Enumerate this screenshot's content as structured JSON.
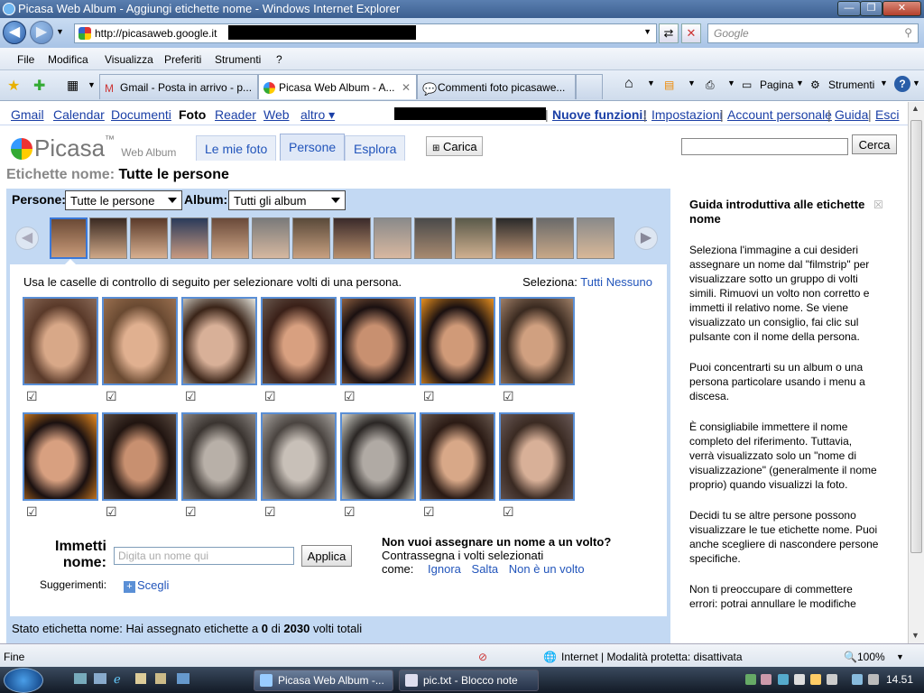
{
  "window": {
    "title": "Picasa Web Album - Aggiungi etichette nome - Windows Internet Explorer"
  },
  "address": {
    "url": "http://picasaweb.google.it",
    "search_placeholder": "Google"
  },
  "menu": [
    "File",
    "Modifica",
    "Visualizza",
    "Preferiti",
    "Strumenti",
    "?"
  ],
  "tabs": [
    {
      "label": "Gmail - Posta in arrivo - p..."
    },
    {
      "label": "Picasa Web Album - A..."
    },
    {
      "label": "Commenti foto picasawe..."
    }
  ],
  "toolbar": {
    "pagina": "Pagina",
    "strumenti": "Strumenti"
  },
  "gbar": {
    "links": [
      "Gmail",
      "Calendar",
      "Documenti",
      "Foto",
      "Reader",
      "Web",
      "altro ▾"
    ],
    "right": [
      "Nuove funzioni!",
      "Impostazioni",
      "Account personale",
      "Guida",
      "Esci"
    ]
  },
  "header": {
    "logo": "Picasa",
    "logo_sub": "Web Album",
    "tabs": [
      "Le mie foto",
      "Persone",
      "Esplora"
    ],
    "upload": "Carica",
    "search_button": "Cerca"
  },
  "page": {
    "title_prefix": "Etichette nome:",
    "title": "Tutte le persone",
    "persone_label": "Persone:",
    "persone_value": "Tutte le persone",
    "album_label": "Album:",
    "album_value": "Tutti gli album",
    "instructions": "Usa le caselle di controllo di seguito per selezionare volti di una persona.",
    "seleziona_label": "Seleziona:",
    "tutti": "Tutti",
    "nessuno": "Nessuno",
    "immetti_nome_1": "Immetti",
    "immetti_nome_2": "nome:",
    "name_placeholder": "Digita un nome qui",
    "applica": "Applica",
    "suggerimenti": "Suggerimenti:",
    "scegli": "Scegli",
    "no_name_title": "Non vuoi assegnare un nome a un volto?",
    "no_name_text1": "Contrassegna i volti selezionati",
    "no_name_text2": "come:",
    "ignora": "Ignora",
    "salta": "Salta",
    "non_volto": "Non è un volto",
    "status_prefix": "Stato etichetta nome:  Hai assegnato etichette a",
    "status_count": "0",
    "status_di": "di",
    "status_total": "2030",
    "status_suffix": "volti totali"
  },
  "guide": {
    "title": "Guida introduttiva alle etichette nome",
    "p1": "Seleziona l'immagine a cui desideri assegnare un nome dal \"filmstrip\" per visualizzare sotto un gruppo di volti simili. Rimuovi un volto non corretto e immetti il relativo nome. Se viene visualizzato un consiglio, fai clic sul pulsante con il nome della persona.",
    "p2": "Puoi concentrarti su un album o una persona particolare usando i menu a discesa.",
    "p3": "È consigliabile immettere il nome completo del riferimento. Tuttavia, verrà visualizzato solo un \"nome di visualizzazione\" (generalmente il nome proprio) quando visualizzi la foto.",
    "p4": "Decidi tu se altre persone possono visualizzare le tue etichette nome. Puoi anche scegliere di nascondere persone specifiche.",
    "p5": "Non ti preoccupare di commettere errori: potrai annullare le modifiche"
  },
  "statusbar": {
    "left": "Fine",
    "zone": "Internet | Modalità protetta: disattivata",
    "zoom": "100%"
  },
  "taskbar": {
    "items": [
      "Picasa Web Album -...",
      "pic.txt - Blocco note"
    ],
    "clock": "14.51"
  },
  "colors": {
    "panel": "#c3d9f3",
    "link": "#1a3fa6",
    "face_border": "#5a8fd6"
  }
}
